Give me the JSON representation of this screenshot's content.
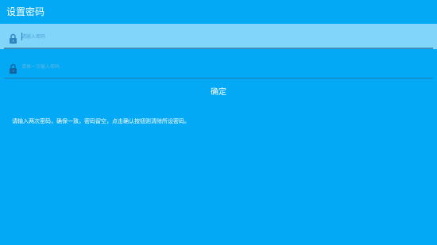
{
  "title_bar": {
    "title": "设置密码"
  },
  "password_field": {
    "placeholder": "请输入密码",
    "value": "",
    "icon": "lock-icon"
  },
  "confirm_field": {
    "placeholder": "请再一次输入密码",
    "value": "",
    "icon": "lock-icon"
  },
  "actions": {
    "confirm_label": "确定"
  },
  "hint": {
    "text": "请输入两次密码，确保一致。密码留空，点击确认按钮则清除所设密码。"
  },
  "colors": {
    "background": "#03A9F4",
    "focused_field": "#81D4FA",
    "text": "#FFFFFF",
    "lock_focused": "#2E86C1",
    "lock_normal": "#1565A0"
  }
}
